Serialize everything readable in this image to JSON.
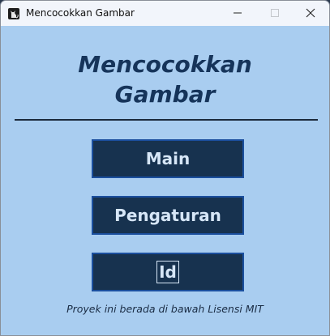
{
  "window": {
    "title": "Mencocokkan Gambar",
    "icon": "cat-icon",
    "controls": [
      "minimize-icon",
      "maximize-icon",
      "close-icon"
    ]
  },
  "main": {
    "heading_line1": "Mencocokkan",
    "heading_line2": "Gambar",
    "buttons": {
      "play": "Main",
      "settings": "Pengaturan",
      "language": "Id"
    },
    "license_text": "Proyek ini berada di bawah Lisensi MIT"
  },
  "colors": {
    "background": "#a9cdf0",
    "button_fill": "#17324f",
    "button_border": "#1b4f9e",
    "button_text": "#d6e6f7",
    "heading": "#16345a",
    "divider": "#1c2a3c"
  }
}
